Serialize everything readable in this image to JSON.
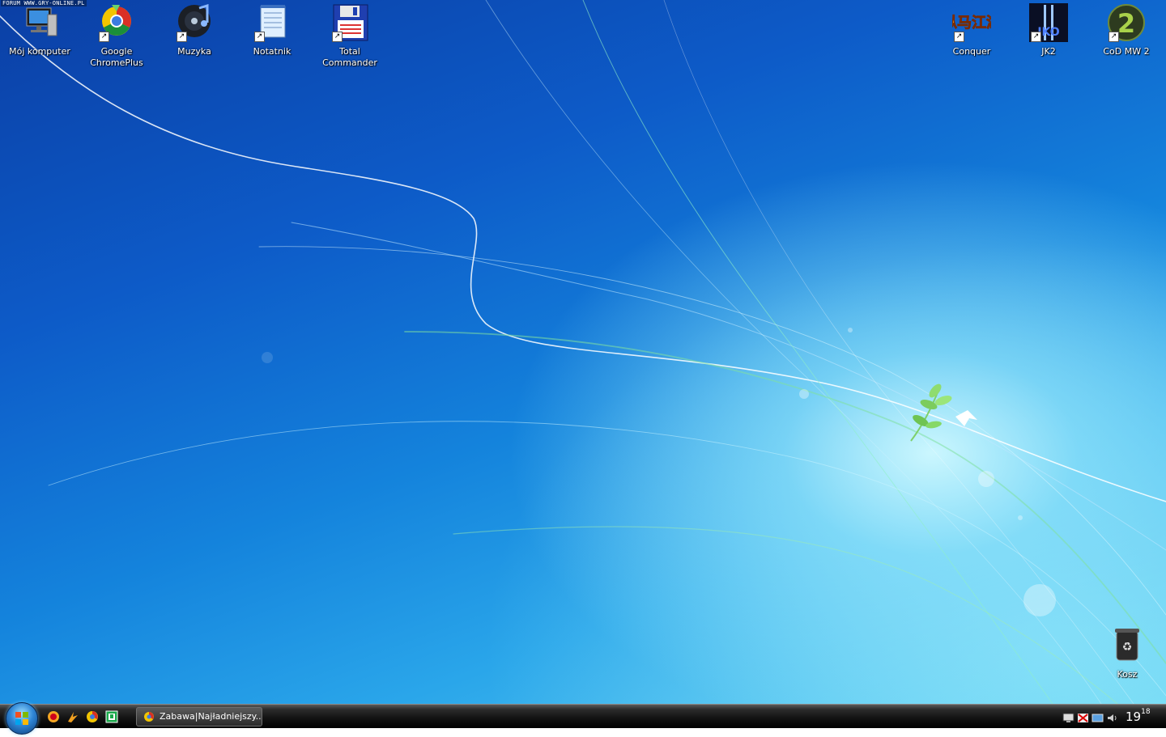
{
  "watermark": "FORUM WWW.GRY-ONLINE.PL",
  "desktop_icons": [
    {
      "name": "moj-komputer",
      "label": "Mój komputer"
    },
    {
      "name": "google-chromeplus",
      "label": "Google\nChromePlus"
    },
    {
      "name": "muzyka",
      "label": "Muzyka"
    },
    {
      "name": "notatnik",
      "label": "Notatnik"
    },
    {
      "name": "total-commander",
      "label": "Total\nCommander"
    },
    {
      "name": "conquer",
      "label": "Conquer"
    },
    {
      "name": "jk2",
      "label": "JK2"
    },
    {
      "name": "cod-mw2",
      "label": "CoD MW 2"
    },
    {
      "name": "kosz",
      "label": "Kosz"
    }
  ],
  "conquer_logo_text": "纵马江湖",
  "jk2_logo_text": "JKO",
  "cod_logo_text": "2",
  "taskbar": {
    "task_label": "Zabawa|Najładniejszy...",
    "clock_hour": "19",
    "clock_minute": "18"
  },
  "colors": {
    "accent_blue": "#1483dc",
    "taskbar_black": "#141414"
  }
}
